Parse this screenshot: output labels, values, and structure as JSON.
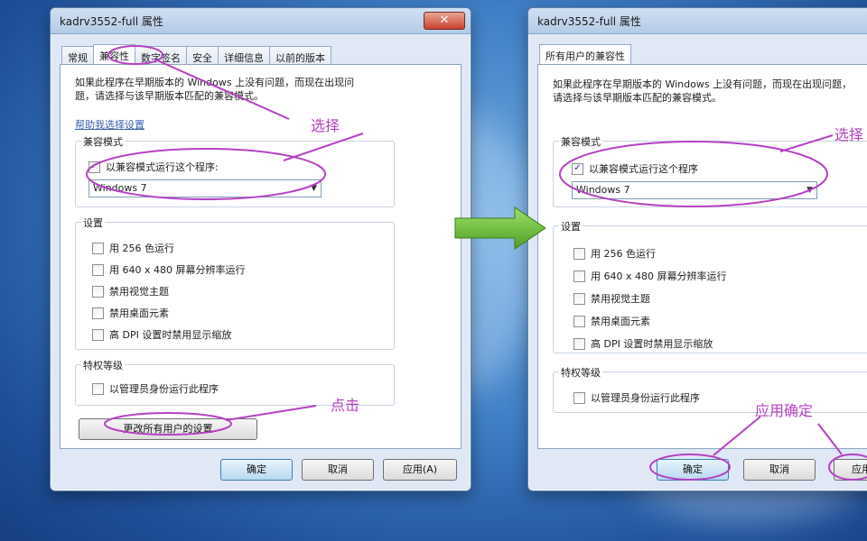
{
  "left_window": {
    "title": "kadrv3552-full 属性",
    "tabs": [
      "常规",
      "兼容性",
      "数字签名",
      "安全",
      "详细信息",
      "以前的版本"
    ],
    "active_tab": "兼容性",
    "description": "如果此程序在早期版本的 Windows 上没有问题，而现在出现问题，请选择与该早期版本匹配的兼容模式。",
    "help_link": "帮助我选择设置",
    "compat_group_title": "兼容模式",
    "compat_checkbox": "以兼容模式运行这个程序:",
    "os_select_value": "Windows 7",
    "settings_group_title": "设置",
    "settings": [
      "用 256 色运行",
      "用 640 x 480 屏幕分辨率运行",
      "禁用视觉主题",
      "禁用桌面元素",
      "高 DPI 设置时禁用显示缩放"
    ],
    "privilege_group_title": "特权等级",
    "privilege_checkbox": "以管理员身份运行此程序",
    "change_all_button": "更改所有用户的设置",
    "ok_button": "确定",
    "cancel_button": "取消",
    "apply_button": "应用(A)"
  },
  "right_window": {
    "title": "kadrv3552-full 属性",
    "tab": "所有用户的兼容性",
    "description": "如果此程序在早期版本的 Windows 上没有问题，而现在出现问题，请选择与该早期版本匹配的兼容模式。",
    "compat_group_title": "兼容模式",
    "compat_checkbox": "以兼容模式运行这个程序",
    "os_select_value": "Windows 7",
    "settings_group_title": "设置",
    "settings": [
      "用 256 色运行",
      "用 640 x 480 屏幕分辨率运行",
      "禁用视觉主题",
      "禁用桌面元素",
      "高 DPI 设置时禁用显示缩放"
    ],
    "privilege_group_title": "特权等级",
    "privilege_checkbox": "以管理员身份运行此程序",
    "ok_button": "确定",
    "cancel_button": "取消",
    "apply_button": "应用"
  },
  "annotations": {
    "select_left": "选择",
    "click_left": "点击",
    "select_right": "选择",
    "apply_confirm": "应用确定"
  },
  "colors": {
    "annotation": "#b541c2",
    "arrow": "#6abf3a"
  }
}
